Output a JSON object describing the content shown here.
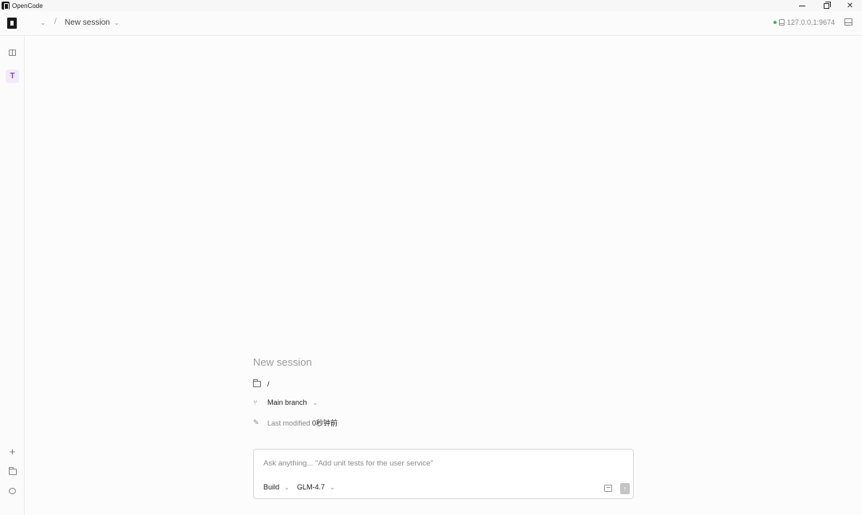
{
  "window": {
    "title": "OpenCode",
    "controls": {
      "minimize": "minimize",
      "restore": "restore",
      "close": "✕"
    }
  },
  "header": {
    "project_chevron": "⌄",
    "separator": "/",
    "session_label": "New session",
    "session_chevron": "⌄",
    "server_address": "127.0.0.1:9674",
    "server_status_color": "#3fb950"
  },
  "sidebar": {
    "toggle_icon": "sidebar-toggle-icon",
    "project_initial": "T",
    "project_color": "#8b3fd6",
    "bottom_icons": [
      "plus-icon",
      "folder-icon",
      "chat-icon"
    ]
  },
  "session": {
    "title": "New session",
    "directory": "/",
    "branch": "Main branch",
    "branch_chevron": "⌄",
    "last_modified_label": "Last modified",
    "last_modified_value": "0秒钟前"
  },
  "prompt": {
    "placeholder": "Ask anything... \"Add unit tests for the user service\"",
    "value": "",
    "agent": "Build",
    "agent_chevron": "⌄",
    "model": "GLM-4.7",
    "model_chevron": "⌄",
    "send_icon": "↑"
  }
}
